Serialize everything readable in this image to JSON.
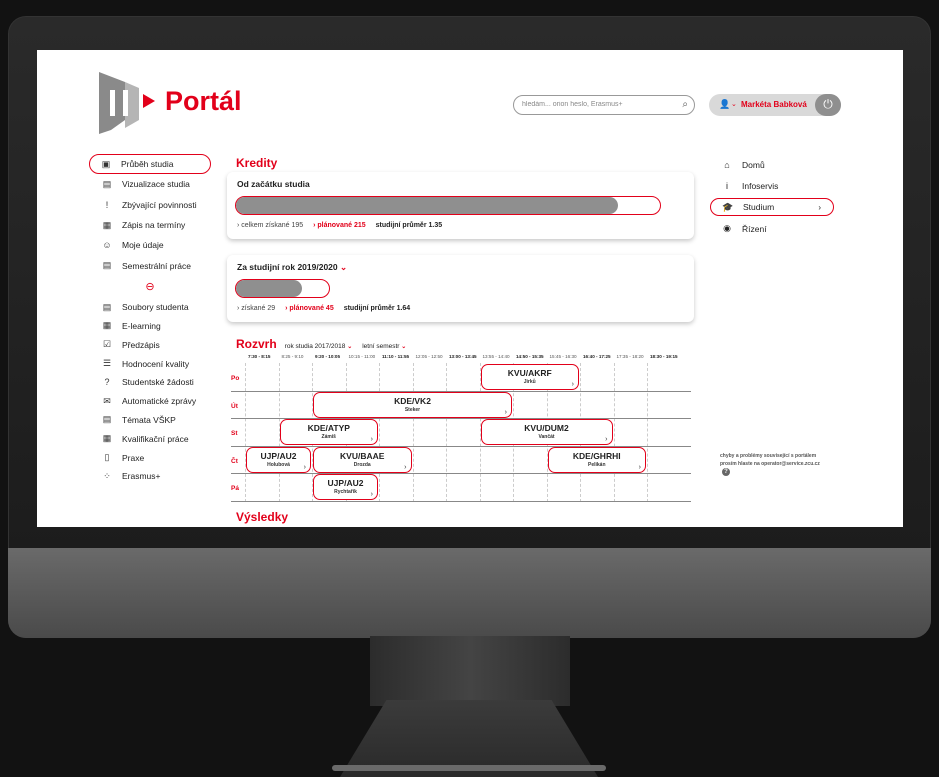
{
  "app": {
    "title": "Portál"
  },
  "search": {
    "placeholder": "hledám... orion heslo, Erasmus+"
  },
  "user": {
    "name": "Markéta Babková"
  },
  "left_nav": [
    {
      "label": "Průběh studia",
      "icon": "timeline-icon",
      "glyph": "▣",
      "active": true
    },
    {
      "label": "Vizualizace studia",
      "icon": "document-chart-icon",
      "glyph": "▤"
    },
    {
      "label": "Zbývající povinnosti",
      "icon": "exclamation-icon",
      "glyph": "!"
    },
    {
      "label": "Zápis na termíny",
      "icon": "calendar-icon",
      "glyph": "▦"
    },
    {
      "label": "Moje údaje",
      "icon": "person-card-icon",
      "glyph": "☺"
    },
    {
      "label": "Semestrální práce",
      "icon": "document-icon",
      "glyph": "▤"
    }
  ],
  "left_nav_more": [
    {
      "label": "Soubory studenta",
      "icon": "files-icon",
      "glyph": "▤"
    },
    {
      "label": "E-learning",
      "icon": "elearning-icon",
      "glyph": "▦"
    },
    {
      "label": "Předzápis",
      "icon": "checkbox-icon",
      "glyph": "☑"
    },
    {
      "label": "Hodnocení kvality",
      "icon": "rating-icon",
      "glyph": "☰"
    },
    {
      "label": "Studentské žádosti",
      "icon": "question-icon",
      "glyph": "?"
    },
    {
      "label": "Automatické zprávy",
      "icon": "mail-icon",
      "glyph": "✉"
    },
    {
      "label": "Témata VŠKP",
      "icon": "topic-icon",
      "glyph": "▤"
    },
    {
      "label": "Kvalifikační práce",
      "icon": "thesis-icon",
      "glyph": "▦"
    },
    {
      "label": "Praxe",
      "icon": "practice-icon",
      "glyph": "▯"
    },
    {
      "label": "Erasmus+",
      "icon": "erasmus-stars-icon",
      "glyph": "⁘"
    }
  ],
  "kredity": {
    "title": "Kredity",
    "total": {
      "title": "Od začátku studia",
      "fill_fraction": 0.9,
      "earned": "› celkem získané 195",
      "planned": "› plánované 215",
      "average": "studijní průměr 1.35"
    },
    "year": {
      "title": "Za studijní rok 2019/2020",
      "fill_fraction": 0.71,
      "earned": "› získané 29",
      "planned": "› plánované 45",
      "average": "studijní průměr 1.64"
    }
  },
  "rozvrh": {
    "title": "Rozvrh",
    "year_filter": "rok studia 2017/2018",
    "semester_filter": "letní semestr",
    "times": [
      "7:30 - 8:15",
      "8:25 - 9:10",
      "9:20 - 10:05",
      "10:15 - 11:00",
      "11:10 - 11:55",
      "12:05 - 12:50",
      "13:00 - 13:45",
      "13:55 - 14:40",
      "14:50 - 15:35",
      "15:45 - 16:30",
      "16:40 - 17:25",
      "17:35 - 18:20",
      "18:30 - 19:15"
    ],
    "days": [
      "Po",
      "Út",
      "St",
      "Čt",
      "Pá"
    ],
    "lessons": [
      {
        "code": "KVU/AKRF",
        "teacher": "Jirků",
        "day": 0,
        "start": 7,
        "span": 3
      },
      {
        "code": "KDE/VK2",
        "teacher": "Steker",
        "day": 1,
        "start": 2,
        "span": 6
      },
      {
        "code": "KDE/ATYP",
        "teacher": "Zámiš",
        "day": 2,
        "start": 1,
        "span": 3
      },
      {
        "code": "KVU/DUM2",
        "teacher": "Vančát",
        "day": 2,
        "start": 7,
        "span": 4
      },
      {
        "code": "UJP/AU2",
        "teacher": "Holubová",
        "day": 3,
        "start": 0,
        "span": 2
      },
      {
        "code": "KVU/BAAE",
        "teacher": "Drozda",
        "day": 3,
        "start": 2,
        "span": 3
      },
      {
        "code": "KDE/GHRHI",
        "teacher": "Pelikán",
        "day": 3,
        "start": 9,
        "span": 3
      },
      {
        "code": "UJP/AU2",
        "teacher": "Rychtařík",
        "day": 4,
        "start": 2,
        "span": 2
      }
    ]
  },
  "vysledky": {
    "title": "Výsledky"
  },
  "right_nav": [
    {
      "label": "Domů",
      "icon": "home-icon",
      "glyph": "⌂"
    },
    {
      "label": "Infoservis",
      "icon": "info-icon",
      "glyph": "i"
    },
    {
      "label": "Studium",
      "icon": "graduation-cap-icon",
      "glyph": "🎓",
      "active": true
    },
    {
      "label": "Řízení",
      "icon": "radio-target-icon",
      "glyph": "◉"
    }
  ],
  "help": {
    "text": "chyby a problémy související s portálem prosím hlaste na operator@service.zcu.cz"
  },
  "colors": {
    "accent": "#e2001a",
    "bar_fill": "#8f8f8f"
  }
}
